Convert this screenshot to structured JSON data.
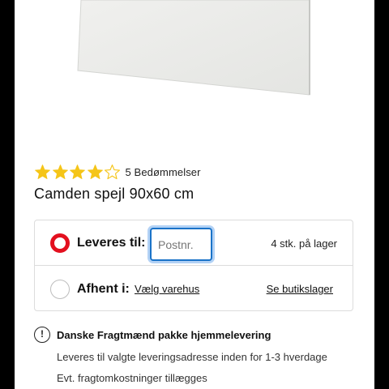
{
  "product": {
    "title": "Camden spejl 90x60 cm",
    "rating_value": 4,
    "rating_max": 5,
    "rating_count_text": "5 Bedømmelser"
  },
  "delivery": {
    "deliver_option": {
      "label": "Leveres til:",
      "selected": true,
      "postcode_placeholder": "Postnr.",
      "postcode_value": "",
      "stock_text": "4 stk. på lager"
    },
    "pickup_option": {
      "label": "Afhent i:",
      "selected": false,
      "choose_store_link": "Vælg varehus",
      "store_stock_link": "Se butikslager"
    }
  },
  "shipping_info": {
    "icon": "exclamation-circle-icon",
    "title": "Danske Fragtmænd pakke hjemmelevering",
    "line_1": "Leveres til valgte leveringsadresse inden for 1-3 hverdage",
    "line_2": "Evt. fragtomkostninger tillægges"
  },
  "colors": {
    "star": "#f5c518",
    "radio_selected": "#e3101f",
    "input_focus": "#1a73c8"
  }
}
